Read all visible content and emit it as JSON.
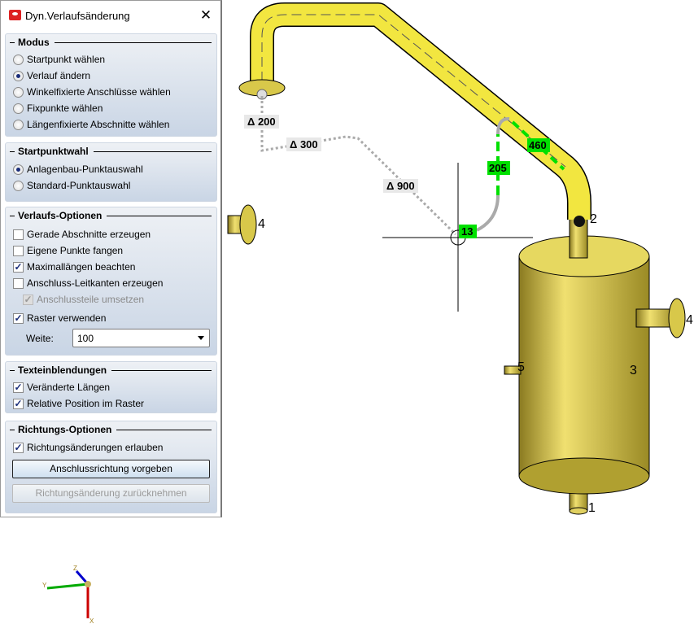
{
  "dialog": {
    "title": "Dyn.Verlaufsänderung",
    "close_icon": "close-icon",
    "modus": {
      "header": "Modus",
      "options": [
        "Startpunkt wählen",
        "Verlauf ändern",
        "Winkelfixierte Anschlüsse wählen",
        "Fixpunkte wählen",
        "Längenfixierte Abschnitte wählen"
      ],
      "selected": "Verlauf ändern"
    },
    "startpunktwahl": {
      "header": "Startpunktwahl",
      "options": [
        "Anlagenbau-Punktauswahl",
        "Standard-Punktauswahl"
      ],
      "selected": "Anlagenbau-Punktauswahl"
    },
    "verlaufs_optionen": {
      "header": "Verlaufs-Optionen",
      "items": [
        {
          "label": "Gerade Abschnitte erzeugen",
          "checked": false
        },
        {
          "label": "Eigene Punkte fangen",
          "checked": false
        },
        {
          "label": "Maximallängen beachten",
          "checked": true
        },
        {
          "label": "Anschluss-Leitkanten erzeugen",
          "checked": false
        },
        {
          "label": "Anschlussteile umsetzen",
          "checked": true,
          "disabled": true
        },
        {
          "label": "Raster verwenden",
          "checked": true
        }
      ],
      "weite_label": "Weite:",
      "weite_value": "100"
    },
    "texteinblendungen": {
      "header": "Texteinblendungen",
      "items": [
        {
          "label": "Veränderte Längen",
          "checked": true
        },
        {
          "label": "Relative Position im Raster",
          "checked": true
        }
      ]
    },
    "richtungs_optionen": {
      "header": "Richtungs-Optionen",
      "items": [
        {
          "label": "Richtungsänderungen erlauben",
          "checked": true
        }
      ],
      "button_primary": "Anschlussrichtung vorgeben",
      "button_disabled": "Richtungsänderung zurücknehmen"
    }
  },
  "viewport": {
    "delta_labels": [
      "Δ 200",
      "Δ 300",
      "Δ 900"
    ],
    "length_labels": [
      "205",
      "460",
      "13"
    ],
    "connector_numbers": [
      "4",
      "2",
      "4",
      "5",
      "3",
      "1"
    ],
    "axes": [
      "X",
      "Y",
      "Z"
    ],
    "colors": {
      "pipe": "#f2e640",
      "vessel": "#d8c84a",
      "highlight": "#00e000",
      "label_bg": "#e8e8e8"
    }
  }
}
